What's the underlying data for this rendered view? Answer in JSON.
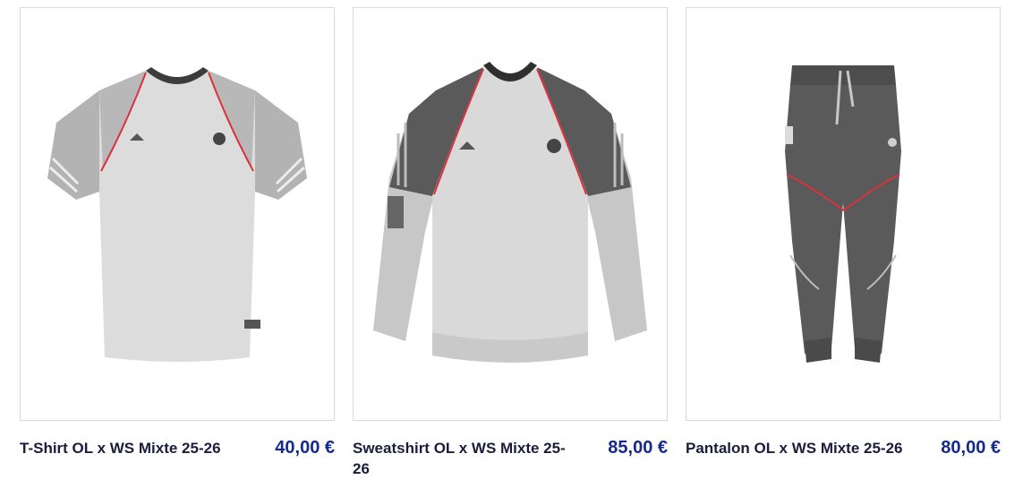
{
  "products": [
    {
      "name": "T-Shirt OL x WS Mixte 25-26",
      "price": "40,00 €",
      "image_icon": "tshirt-product-image"
    },
    {
      "name": "Sweatshirt OL x WS Mixte 25-26",
      "price": "85,00 €",
      "image_icon": "sweatshirt-product-image"
    },
    {
      "name": "Pantalon OL x WS Mixte 25-26",
      "price": "80,00 €",
      "image_icon": "pants-product-image"
    }
  ],
  "colors": {
    "price": "#142a8c",
    "title": "#1a1d3d",
    "card_border": "#d9d9d9",
    "accent_red": "#d9323a"
  }
}
